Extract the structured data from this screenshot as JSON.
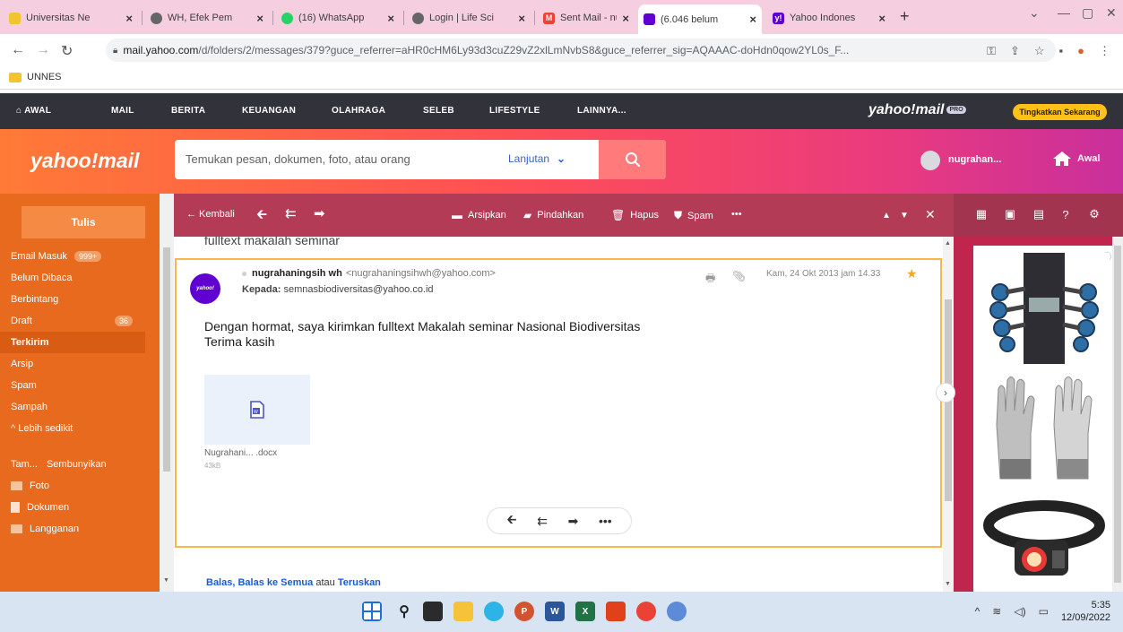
{
  "browser": {
    "tabs": [
      {
        "label": "Universitas Ne",
        "icon": "unnes-favicon",
        "color": "#f4c430"
      },
      {
        "label": "WH, Efek Pem",
        "icon": "globe-favicon",
        "color": "#555555"
      },
      {
        "label": "(16) WhatsApp",
        "icon": "whatsapp-favicon",
        "color": "#25d366"
      },
      {
        "label": "Login | Life Sci",
        "icon": "globe-favicon",
        "color": "#555555"
      },
      {
        "label": "Sent Mail - nu",
        "icon": "gmail-favicon",
        "color": "#ea4335"
      },
      {
        "label": "(6.046 belum",
        "icon": "yahoo-mail-favicon",
        "color": "#6001d2"
      },
      {
        "label": "Yahoo Indones",
        "icon": "yahoo-favicon",
        "color": "#6001d2"
      }
    ],
    "url_host": "mail.yahoo.com",
    "url_path": "/d/folders/2/messages/379?guce_referrer=aHR0cHM6Ly93d3cuZ29vZ2xlLmNvbS8&guce_referrer_sig=AQAAAC-doHdn0qow2YL0s_F...",
    "bookmark": "UNNES"
  },
  "topnav": {
    "items": [
      "AWAL",
      "MAIL",
      "BERITA",
      "KEUANGAN",
      "OLAHRAGA",
      "SELEB",
      "LIFESTYLE",
      "LAINNYA..."
    ],
    "logo": "yahoo!mail",
    "pro_badge": "PRO",
    "upgrade_label": "Tingkatkan Sekarang"
  },
  "header": {
    "logo": "yahoo!mail",
    "search_placeholder": "Temukan pesan, dokumen, foto, atau orang",
    "advanced_label": "Lanjutan",
    "user_name": "nugrahan...",
    "home_label": "Awal"
  },
  "sidebar": {
    "compose_label": "Tulis",
    "inbox_label": "Email Masuk",
    "inbox_count": "999+",
    "unread_label": "Belum Dibaca",
    "starred_label": "Berbintang",
    "drafts_label": "Draft",
    "drafts_count": "36",
    "sent_label": "Terkirim",
    "archive_label": "Arsip",
    "spam_label": "Spam",
    "trash_label": "Sampah",
    "less_label": "^ Lebih sedikit",
    "views_label": "Tam...",
    "hide_label": "Sembunyikan",
    "photos_label": "Foto",
    "documents_label": "Dokumen",
    "subscriptions_label": "Langganan"
  },
  "toolbar": {
    "back_label": "← Kembali",
    "archive_label": "Arsipkan",
    "move_label": "Pindahkan",
    "delete_label": "Hapus",
    "spam_label": "Spam",
    "more_label": "•••"
  },
  "message": {
    "subject": "fulltext makalah seminar",
    "sender_name": "nugrahaningsih wh",
    "sender_email": "<nugrahaningsihwh@yahoo.com>",
    "to_label": "Kepada:",
    "to_address": "semnasbiodiversitas@yahoo.co.id",
    "date": "Kam, 24 Okt 2013 jam 14.33",
    "avatar_label": "yahoo!",
    "body_line1": "Dengan hormat, saya kirimkan fulltext Makalah seminar Nasional Biodiversitas",
    "body_line2": "Terima kasih",
    "attachment_name": "Nugrahani... .docx",
    "attachment_size": "43kB",
    "reply_link": "Balas,",
    "reply_all_link": "Balas ke Semua",
    "or_label": "atau",
    "forward_link": "Teruskan"
  },
  "taskbar": {
    "time": "5:35",
    "date": "12/09/2022"
  },
  "colors": {
    "sidebar": "#e86a1f",
    "toolbar": "#b33b55",
    "accent_star": "#f5a623",
    "card_border": "#f5b849"
  }
}
